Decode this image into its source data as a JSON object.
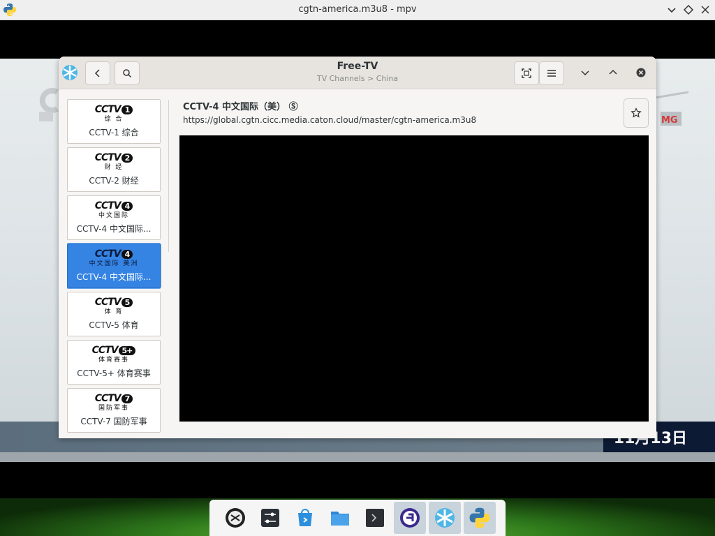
{
  "mpv": {
    "title": "cgtn-america.m3u8 - mpv",
    "icons": {
      "app": "python-icon",
      "minimize": "chevron-down-icon",
      "maximize": "diamond-icon",
      "close": "close-icon"
    }
  },
  "video": {
    "ticker_date": "11月13日"
  },
  "freetv": {
    "title": "Free-TV",
    "subtitle": "TV Channels > China",
    "channels": [
      {
        "logo_num": "1",
        "logo_sub": "综 合",
        "name": "CCTV-1 综合",
        "selected": false
      },
      {
        "logo_num": "2",
        "logo_sub": "财 经",
        "name": "CCTV-2 财经",
        "selected": false
      },
      {
        "logo_num": "4",
        "logo_sub": "中文国际",
        "name": "CCTV-4 中文国际...",
        "selected": false
      },
      {
        "logo_num": "4",
        "logo_sub": "中文国际 美洲",
        "name": "CCTV-4 中文国际...",
        "selected": true
      },
      {
        "logo_num": "5",
        "logo_sub": "体 育",
        "name": "CCTV-5 体育",
        "selected": false
      },
      {
        "logo_num": "5+",
        "logo_sub": "体育赛事",
        "name": "CCTV-5+ 体育赛事",
        "selected": false
      },
      {
        "logo_num": "7",
        "logo_sub": "国防军事",
        "name": "CCTV-7 国防军事",
        "selected": false
      }
    ],
    "logo_mark": "CCTV",
    "detail": {
      "title": "CCTV-4 中文国际（美）",
      "badge": "Ⓢ",
      "url": "https://global.cgtn.cicc.media.caton.cloud/master/cgtn-america.m3u8"
    }
  },
  "dock": {
    "items": [
      "linux-penguin-icon",
      "settings-sliders-icon",
      "software-store-icon",
      "files-folder-icon",
      "terminal-icon",
      "fedora-icon",
      "freetv-snowflake-icon",
      "python-icon"
    ]
  }
}
